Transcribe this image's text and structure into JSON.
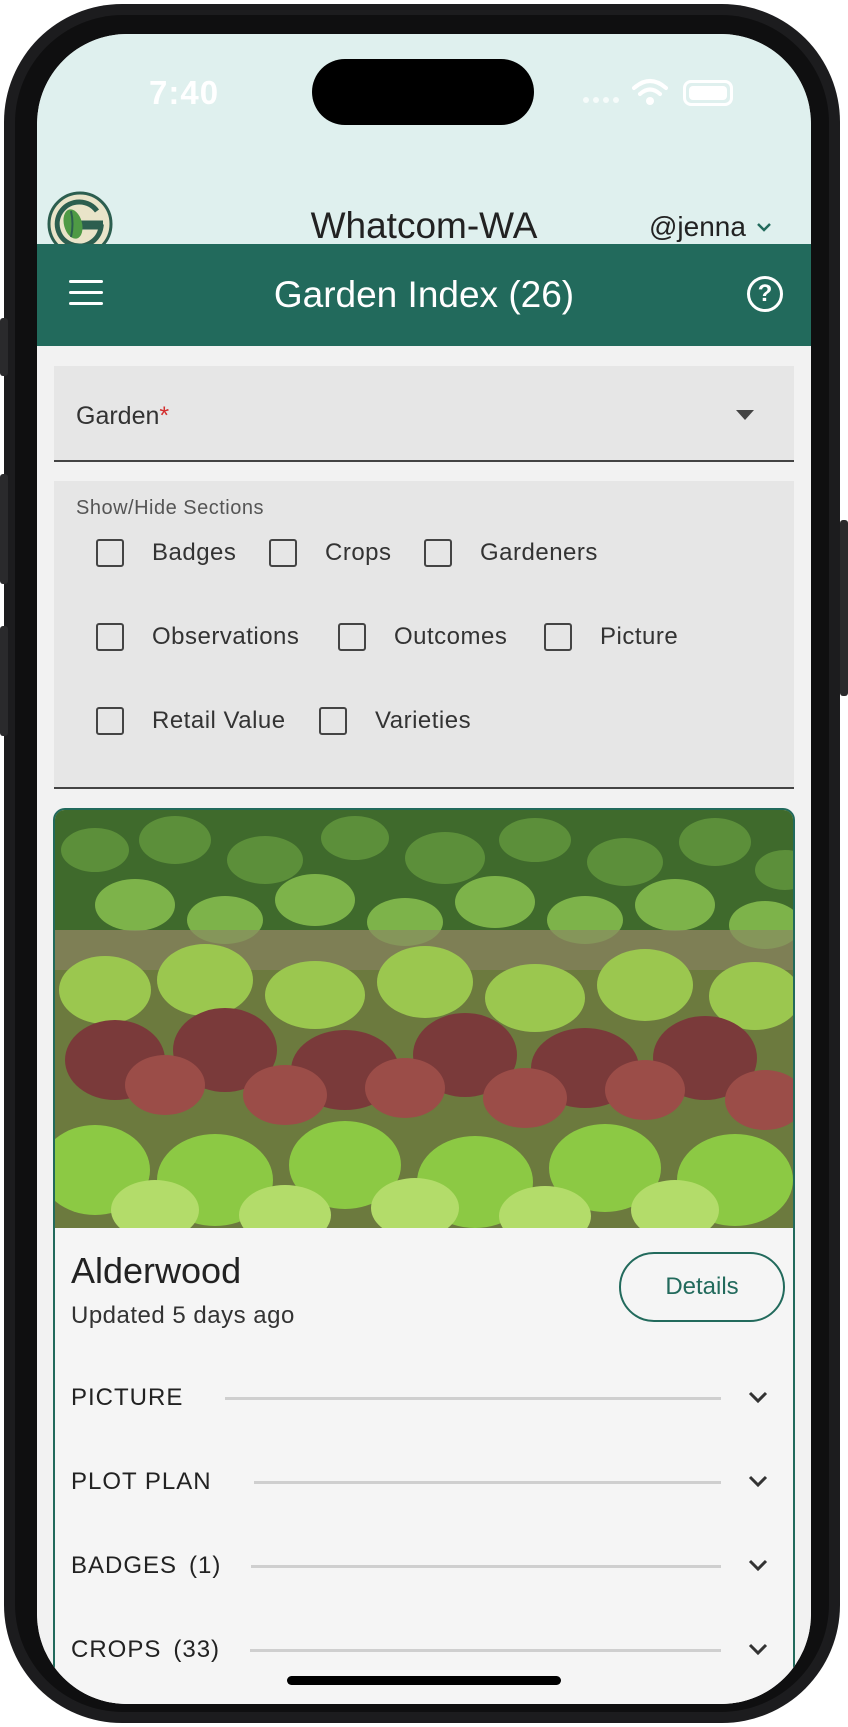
{
  "status": {
    "time": "7:40"
  },
  "header": {
    "location": "Whatcom-WA",
    "user": "@jenna"
  },
  "appbar": {
    "title": "Garden Index (26)"
  },
  "garden_select": {
    "label": "Garden",
    "required_mark": "*"
  },
  "sections": {
    "title": "Show/Hide Sections",
    "options": [
      "Badges",
      "Crops",
      "Gardeners",
      "Observations",
      "Outcomes",
      "Picture",
      "Retail Value",
      "Varieties"
    ]
  },
  "card": {
    "title": "Alderwood",
    "subtitle": "Updated 5 days ago",
    "details_label": "Details",
    "accordions": [
      {
        "label": "PICTURE",
        "count": ""
      },
      {
        "label": "PLOT PLAN",
        "count": ""
      },
      {
        "label": "BADGES",
        "count": "(1)"
      },
      {
        "label": "CROPS",
        "count": "(33)"
      }
    ]
  },
  "colors": {
    "brand": "#226a5c",
    "header_bg": "#dff0ee",
    "required": "#d32f2f"
  },
  "icons": [
    "garden-logo-icon",
    "chevron-down-icon",
    "menu-icon",
    "help-icon",
    "dropdown-arrow-icon",
    "checkbox-icon"
  ]
}
